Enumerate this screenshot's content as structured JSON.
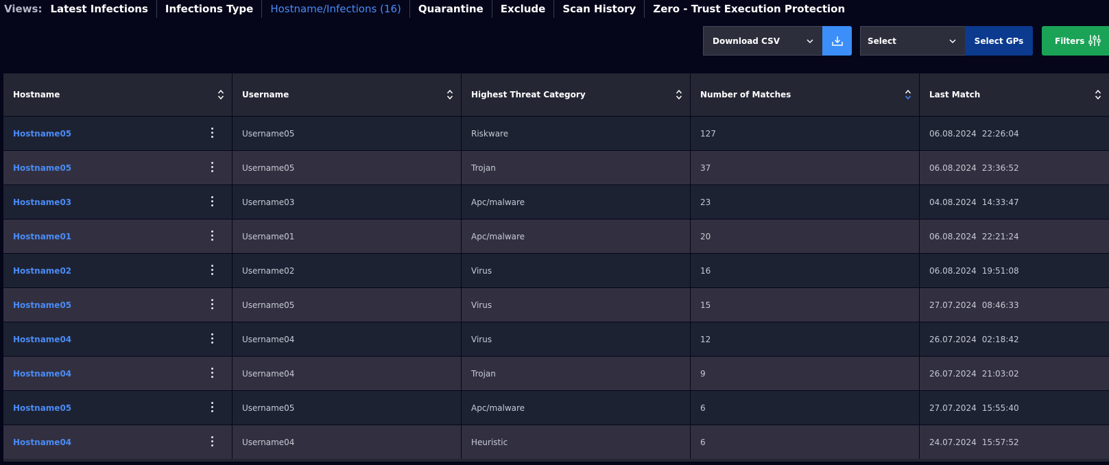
{
  "views": {
    "label": "Views:",
    "tabs": [
      {
        "label": "Latest Infections",
        "active": false
      },
      {
        "label": "Infections Type",
        "active": false
      },
      {
        "label": "Hostname/Infections (16)",
        "active": true
      },
      {
        "label": "Quarantine",
        "active": false
      },
      {
        "label": "Exclude",
        "active": false
      },
      {
        "label": "Scan History",
        "active": false
      },
      {
        "label": "Zero - Trust Execution Protection",
        "active": false
      }
    ]
  },
  "toolbar": {
    "download_select": "Download CSV",
    "download_icon": "download-icon",
    "gp_select": "Select",
    "select_gps_button": "Select GPs",
    "filters_button": "Filters",
    "filters_icon": "sliders-icon"
  },
  "table": {
    "columns": [
      "Hostname",
      "Username",
      "Highest Threat Category",
      "Number of Matches",
      "Last Match"
    ],
    "sorted_column": "Number of Matches",
    "sort_direction": "desc",
    "rows": [
      {
        "hostname": "Hostname05",
        "username": "Username05",
        "category": "Riskware",
        "matches": "127",
        "date": "06.08.2024",
        "time": "22:26:04"
      },
      {
        "hostname": "Hostname05",
        "username": "Username05",
        "category": "Trojan",
        "matches": "37",
        "date": "06.08.2024",
        "time": "23:36:52"
      },
      {
        "hostname": "Hostname03",
        "username": "Username03",
        "category": "Apc/malware",
        "matches": "23",
        "date": "04.08.2024",
        "time": "14:33:47"
      },
      {
        "hostname": "Hostname01",
        "username": "Username01",
        "category": "Apc/malware",
        "matches": "20",
        "date": "06.08.2024",
        "time": "22:21:24"
      },
      {
        "hostname": "Hostname02",
        "username": "Username02",
        "category": "Virus",
        "matches": "16",
        "date": "06.08.2024",
        "time": "19:51:08"
      },
      {
        "hostname": "Hostname05",
        "username": "Username05",
        "category": "Virus",
        "matches": "15",
        "date": "27.07.2024",
        "time": "08:46:33"
      },
      {
        "hostname": "Hostname04",
        "username": "Username04",
        "category": "Virus",
        "matches": "12",
        "date": "26.07.2024",
        "time": "02:18:42"
      },
      {
        "hostname": "Hostname04",
        "username": "Username04",
        "category": "Trojan",
        "matches": "9",
        "date": "26.07.2024",
        "time": "21:03:02"
      },
      {
        "hostname": "Hostname05",
        "username": "Username05",
        "category": "Apc/malware",
        "matches": "6",
        "date": "27.07.2024",
        "time": "15:55:40"
      },
      {
        "hostname": "Hostname04",
        "username": "Username04",
        "category": "Heuristic",
        "matches": "6",
        "date": "24.07.2024",
        "time": "15:57:52"
      }
    ]
  },
  "colors": {
    "accent": "#4a8bf5",
    "download_button": "#3c8ef8",
    "select_gps_button": "#0b3a8f",
    "filters_button": "#1aa356",
    "background": "#05061a"
  }
}
